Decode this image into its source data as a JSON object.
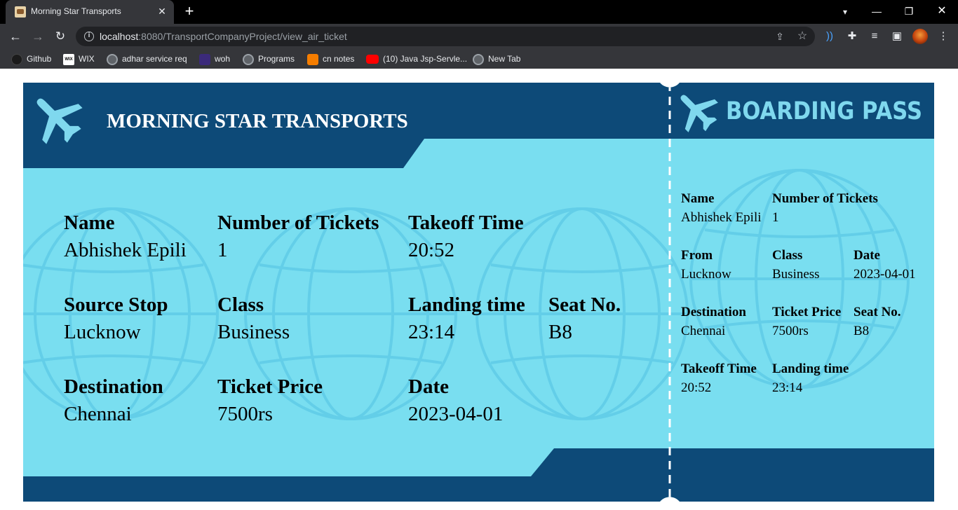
{
  "browser": {
    "tab_title": "Morning Star Transports",
    "tab_close": "✕",
    "new_tab": "+",
    "url_host": "localhost",
    "url_rest": ":8080/TransportCompanyProject/view_air_ticket",
    "bookmarks": [
      "Github",
      "WIX",
      "adhar service req",
      "woh",
      "Programs",
      "cn notes",
      "(10) Java Jsp-Servle...",
      "New Tab"
    ]
  },
  "ticket": {
    "company": "MORNING STAR TRANSPORTS",
    "boarding_pass": "BOARDING PASS",
    "colors": {
      "dark": "#0d4a78",
      "light": "#79def0",
      "globe": "#5cc9e6",
      "plane": "#7fd8ee"
    },
    "main": {
      "name_label": "Name",
      "name_value": "Abhishek Epili",
      "tickets_label": "Number of Tickets",
      "tickets_value": "1",
      "takeoff_label": "Takeoff Time",
      "takeoff_value": "20:52",
      "source_label": "Source Stop",
      "source_value": "Lucknow",
      "class_label": "Class",
      "class_value": "Business",
      "landing_label": "Landing time",
      "landing_value": "23:14",
      "seat_label": "Seat No.",
      "seat_value": "B8",
      "dest_label": "Destination",
      "dest_value": "Chennai",
      "price_label": "Ticket Price",
      "price_value": "7500rs",
      "date_label": "Date",
      "date_value": "2023-04-01"
    },
    "stub": {
      "name_label": "Name",
      "name_value": "Abhishek Epili",
      "tickets_label": "Number of Tickets",
      "tickets_value": "1",
      "from_label": "From",
      "from_value": "Lucknow",
      "class_label": "Class",
      "class_value": "Business",
      "date_label": "Date",
      "date_value": "2023-04-01",
      "dest_label": "Destination",
      "dest_value": "Chennai",
      "price_label": "Ticket Price",
      "price_value": "7500rs",
      "seat_label": "Seat No.",
      "seat_value": "B8",
      "takeoff_label": "Takeoff Time",
      "takeoff_value": "20:52",
      "landing_label": "Landing time",
      "landing_value": "23:14"
    }
  }
}
